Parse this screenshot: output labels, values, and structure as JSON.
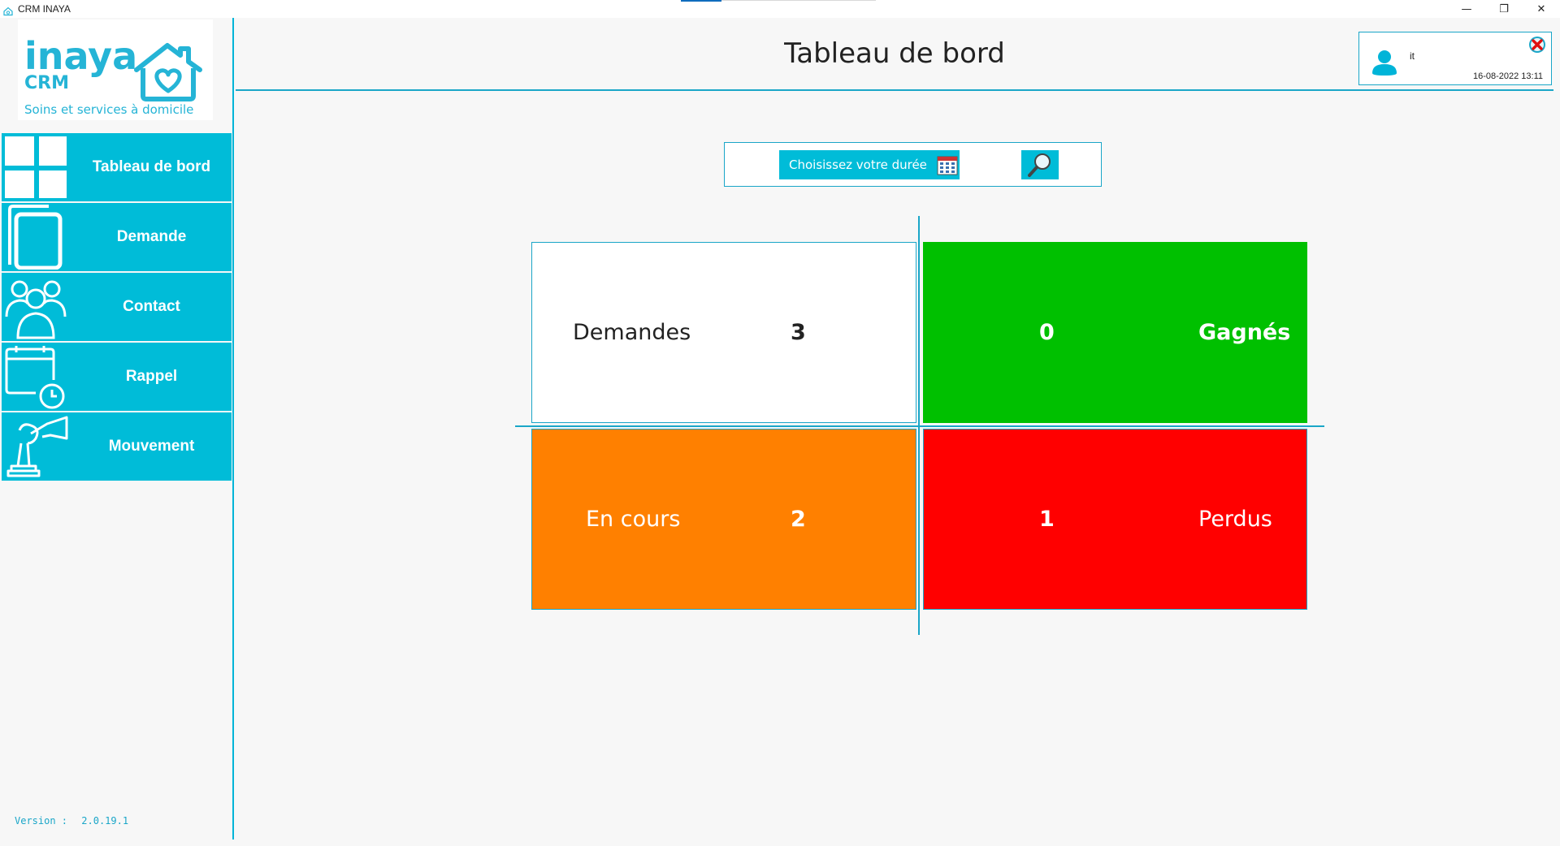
{
  "window": {
    "title": "CRM INAYA",
    "controls": {
      "minimize": "—",
      "restore": "❐",
      "close": "✕"
    }
  },
  "logo": {
    "brand": "inaya",
    "product": "CRM",
    "tagline": "Soins et services à domicile",
    "color": "#25b4d6"
  },
  "sidebar": {
    "items": [
      {
        "label": "Tableau de bord",
        "icon": "dashboard-grid-icon"
      },
      {
        "label": "Demande",
        "icon": "tablet-icon"
      },
      {
        "label": "Contact",
        "icon": "contacts-group-icon"
      },
      {
        "label": "Rappel",
        "icon": "calendar-clock-icon"
      },
      {
        "label": "Mouvement",
        "icon": "chess-piece-icon"
      }
    ],
    "version_label": "Version :",
    "version_value": "2.0.19.1"
  },
  "header": {
    "title": "Tableau de bord",
    "user": {
      "name": "it",
      "datetime": "16-08-2022 13:11"
    }
  },
  "filter": {
    "duration_label": "Choisissez votre durée"
  },
  "stats": {
    "demandes": {
      "label": "Demandes",
      "count": "3"
    },
    "gagnes": {
      "label": "Gagnés",
      "count": "0"
    },
    "en_cours": {
      "label": "En cours",
      "count": "2"
    },
    "perdus": {
      "label": "Perdus",
      "count": "1"
    }
  },
  "colors": {
    "accent": "#00bcd8",
    "won": "#00c000",
    "in_progress": "#ff8000",
    "lost": "#ff0000"
  }
}
